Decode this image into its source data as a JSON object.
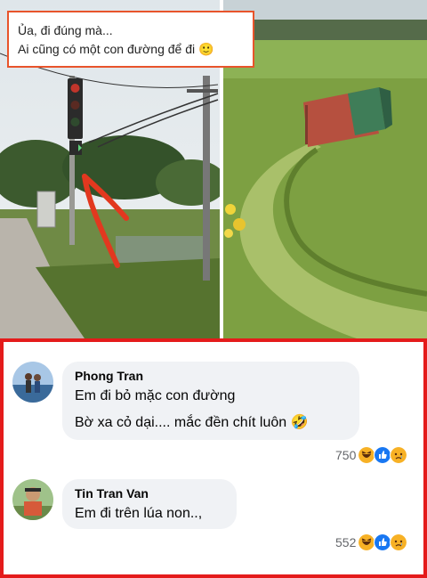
{
  "caption": {
    "line1": "Ủa, đi đúng mà...",
    "line2": "Ai cũng có một con đường để đi 🙂"
  },
  "comments": [
    {
      "author": "Phong Tran",
      "lines": [
        "Em đi bỏ mặc con đường",
        "Bờ xa cỏ dại.... mắc đền chít luôn 🤣"
      ],
      "reaction_count": "750",
      "reactions": [
        "haha-icon",
        "like-icon",
        "sad-icon"
      ]
    },
    {
      "author": "Tin Tran Van",
      "lines": [
        "Em đi trên lúa non..,"
      ],
      "reaction_count": "552",
      "reactions": [
        "haha-icon",
        "like-icon",
        "sad-icon"
      ]
    }
  ],
  "colors": {
    "frame": "#e41b1b",
    "caption_border": "#e8542b",
    "bubble": "#f0f2f5",
    "like": "#1877f2",
    "haha": "#f7b125"
  }
}
